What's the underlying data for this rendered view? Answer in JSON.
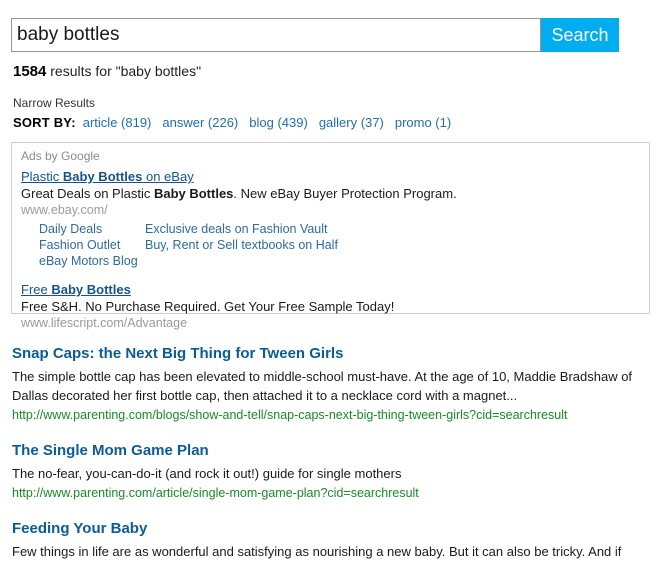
{
  "search": {
    "query_value": "baby bottles",
    "placeholder": "Search",
    "button_label": "Search"
  },
  "results_summary": {
    "count": "1584",
    "suffix": " results for \"baby bottles\""
  },
  "narrow": {
    "label": "Narrow Results"
  },
  "sort": {
    "label": "SORT BY:",
    "options": [
      {
        "label": "article (819)"
      },
      {
        "label": "answer (226)"
      },
      {
        "label": "blog (439)"
      },
      {
        "label": "gallery (37)"
      },
      {
        "label": "promo (1)"
      }
    ]
  },
  "ads": {
    "label": "Ads by Google",
    "items": [
      {
        "title_prefix": "Plastic ",
        "title_bold": "Baby Bottles",
        "title_suffix": " on eBay",
        "desc_prefix": "Great Deals on Plastic ",
        "desc_bold": "Baby Bottles",
        "desc_suffix": ". New eBay Buyer Protection Program.",
        "url": "www.ebay.com/",
        "sublinks": [
          {
            "left": "Daily Deals",
            "right": "Exclusive deals on Fashion Vault"
          },
          {
            "left": "Fashion Outlet",
            "right": "Buy, Rent or Sell textbooks on Half"
          },
          {
            "left": "eBay Motors Blog",
            "right": ""
          }
        ]
      },
      {
        "title_prefix": "Free ",
        "title_bold": "Baby Bottles",
        "title_suffix": "",
        "desc_prefix": "Free S&H. No Purchase Required. Get Your Free Sample Today!",
        "desc_bold": "",
        "desc_suffix": "",
        "url": "www.lifescript.com/Advantage",
        "sublinks": []
      }
    ]
  },
  "results": {
    "items": [
      {
        "title": "Snap Caps: the Next Big Thing for Tween Girls",
        "snippet": "The simple bottle cap has been elevated to middle-school must-have. At the age of 10, Maddie Bradshaw of Dallas decorated her first bottle cap, then attached it to a necklace cord with a magnet...",
        "url": "http://www.parenting.com/blogs/show-and-tell/snap-caps-next-big-thing-tween-girls?cid=searchresult"
      },
      {
        "title": "The Single Mom Game Plan",
        "snippet": "The no-fear, you-can-do-it (and rock it out!) guide for single mothers",
        "url": "http://www.parenting.com/article/single-mom-game-plan?cid=searchresult"
      },
      {
        "title": "Feeding Your Baby",
        "snippet": "Few things in life are as wonderful and satisfying as nourishing a new baby. But it can also be tricky. And if",
        "url": ""
      }
    ]
  },
  "colors": {
    "search_button": "#00aeef",
    "link_blue": "#1f6fad",
    "result_title": "#0a5c99",
    "result_url_green": "#1a8a26",
    "ad_title": "#16538c",
    "ad_url_gray": "#9a9a9a"
  }
}
